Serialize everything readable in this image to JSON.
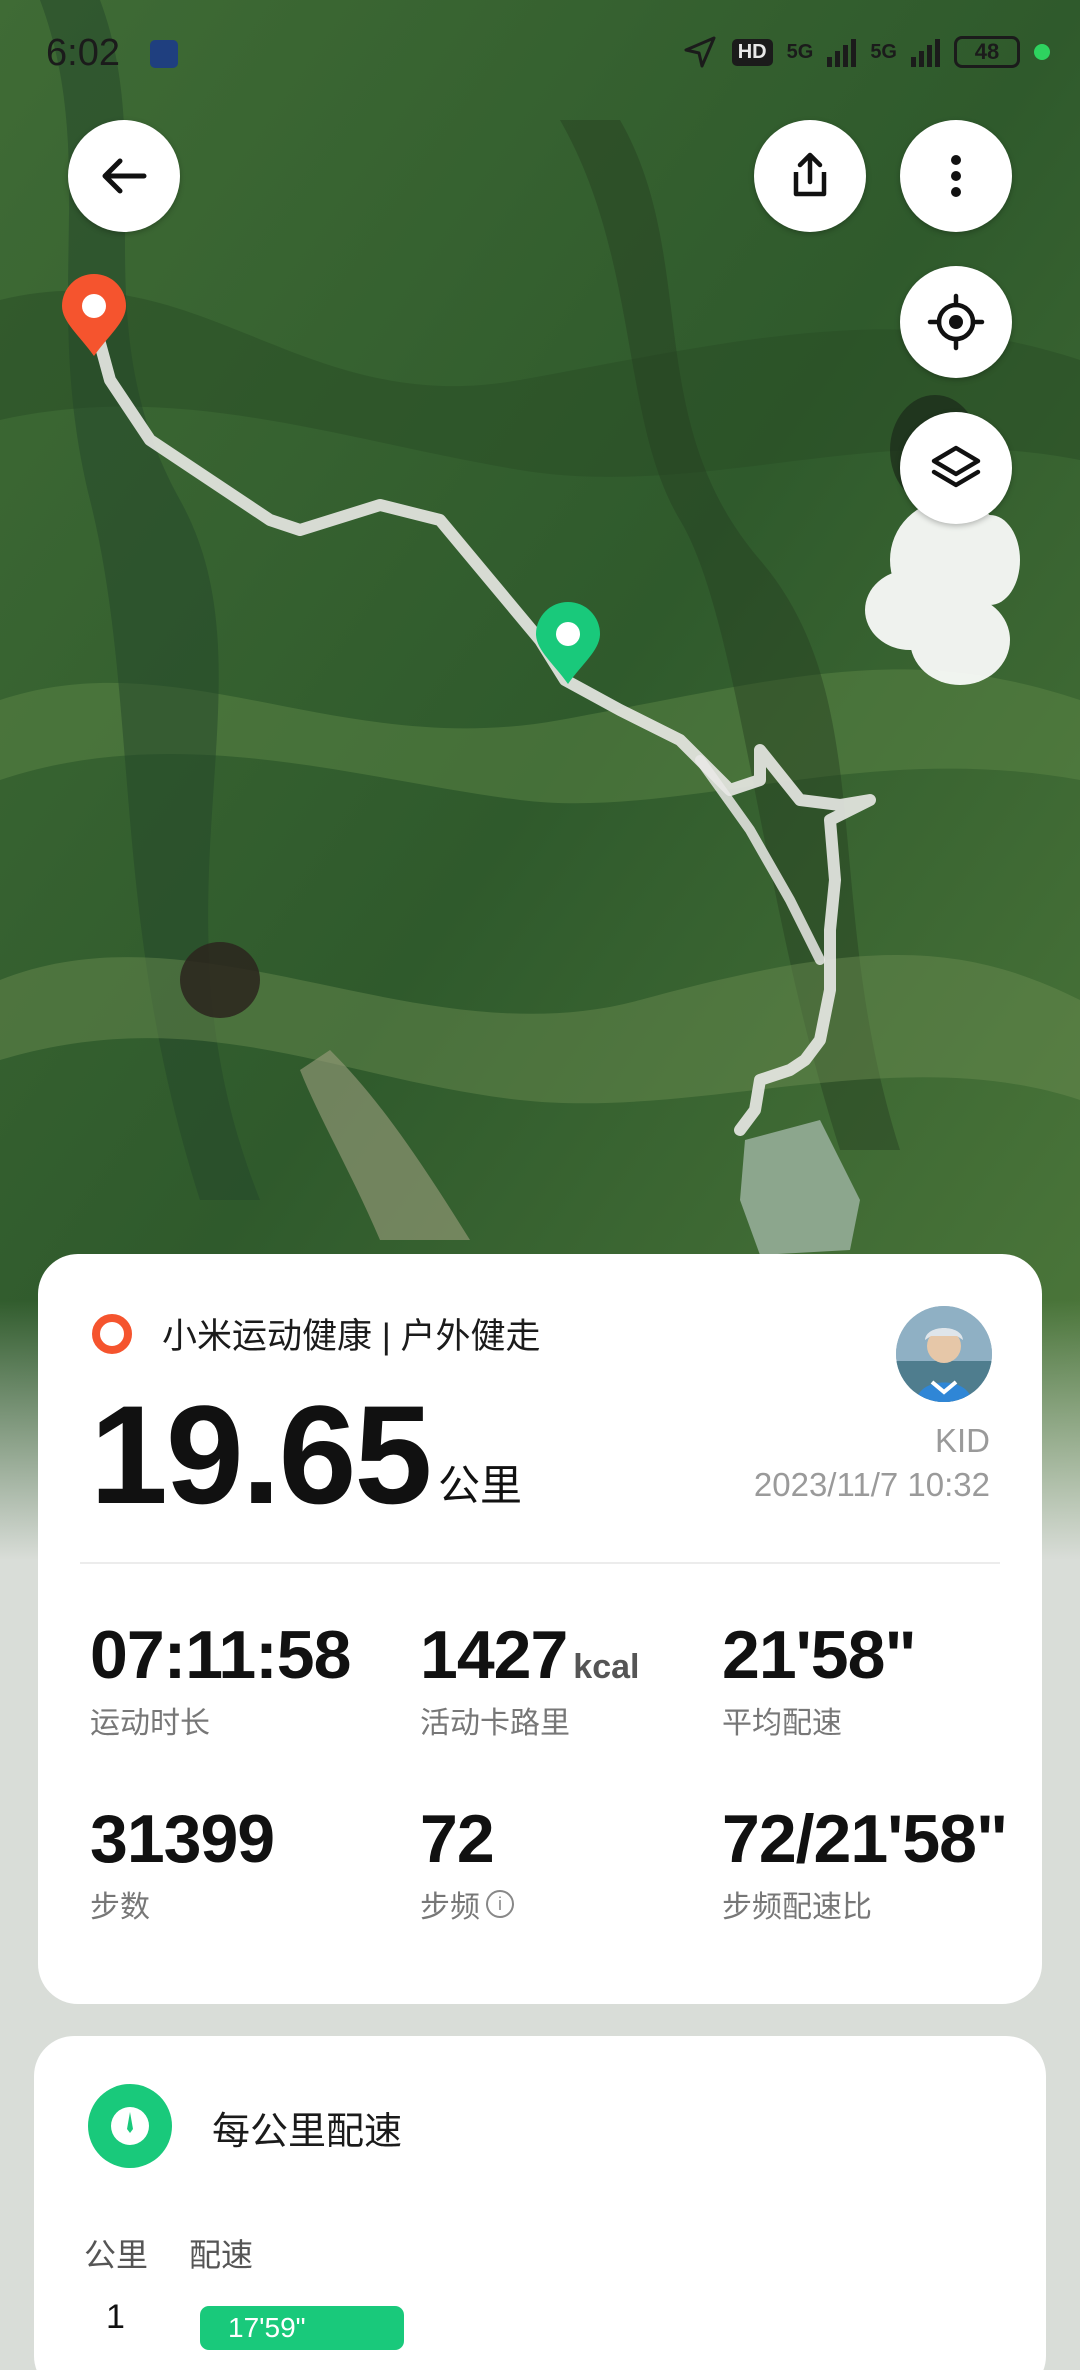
{
  "status_bar": {
    "time": "6:02",
    "hd_label": "HD",
    "net1": "5G",
    "net2": "5G",
    "battery": "48"
  },
  "map": {
    "start_pin_color": "#f5542e",
    "end_pin_color": "#19c97b"
  },
  "summary": {
    "source": "小米运动健康 | 户外健走",
    "distance": "19.65",
    "distance_unit": "公里",
    "user": "KID",
    "datetime": "2023/11/7 10:32",
    "stats": [
      {
        "value": "07:11:58",
        "unit": "",
        "label": "运动时长"
      },
      {
        "value": "1427",
        "unit": "kcal",
        "label": "活动卡路里"
      },
      {
        "value": "21'58\"",
        "unit": "",
        "label": "平均配速"
      },
      {
        "value": "31399",
        "unit": "",
        "label": "步数"
      },
      {
        "value": "72",
        "unit": "",
        "label": "步频"
      },
      {
        "value": "72/21'58\"",
        "unit": "",
        "label": "步频配速比"
      }
    ]
  },
  "pace": {
    "title": "每公里配速",
    "col_km": "公里",
    "col_pace": "配速",
    "rows": [
      {
        "km": "1",
        "pace": "17'59\""
      }
    ]
  },
  "colors": {
    "accent_green": "#19c97b",
    "accent_orange": "#f5542e"
  }
}
